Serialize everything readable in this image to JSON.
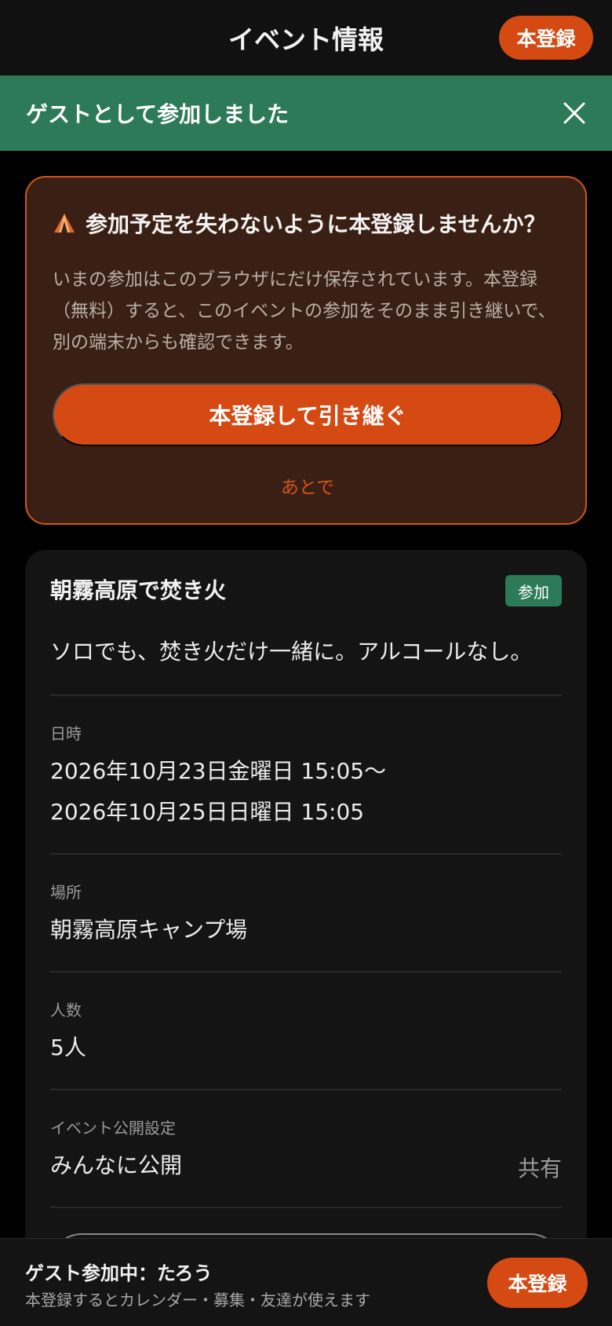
{
  "header": {
    "title": "イベント情報",
    "register_label": "本登録"
  },
  "toast": {
    "message": "ゲストとして参加しました",
    "close_icon": "close-icon"
  },
  "notice": {
    "icon": "tent-icon",
    "title": "参加予定を失わないように本登録しませんか？",
    "body": "いまの参加はこのブラウザにだけ保存されています。本登録（無料）すると、このイベントの参加をそのまま引き継いで、別の端末からも確認できます。",
    "cta_label": "本登録して引き継ぐ",
    "later_label": "あとで"
  },
  "event": {
    "title": "朝霧高原で焚き火",
    "badge": "参加",
    "description": "ソロでも、焚き火だけ一緒に。アルコールなし。",
    "datetime_label": "日時",
    "datetime_start": "2026年10月23日金曜日 15:05〜",
    "datetime_end": "2026年10月25日日曜日 15:05",
    "place_label": "場所",
    "place_value": "朝霧高原キャンプ場",
    "people_label": "人数",
    "people_value": "5人",
    "visibility_label": "イベント公開設定",
    "visibility_value": "みんなに公開",
    "share_label": "共有"
  },
  "bottombar": {
    "title": "ゲスト参加中：たろう",
    "subtitle": "本登録するとカレンダー・募集・友達が使えます",
    "register_label": "本登録"
  },
  "colors": {
    "accent": "#D44A12",
    "success": "#2C7A58",
    "notice_bg": "#3A1F14",
    "card_bg": "#141414"
  }
}
